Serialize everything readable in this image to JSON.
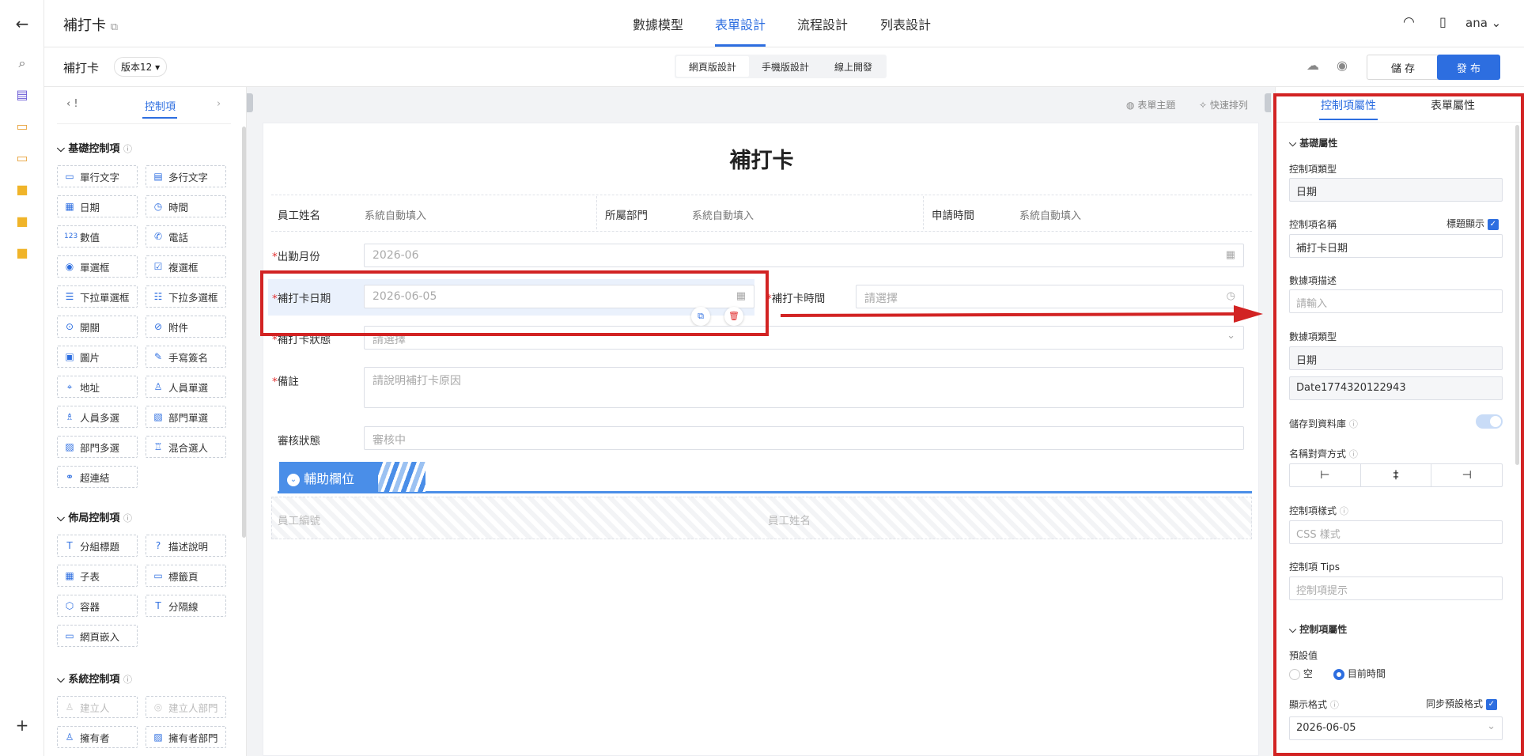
{
  "app": {
    "title": "補打卡",
    "user": "ana"
  },
  "nav": {
    "tabs": [
      "數據模型",
      "表單設計",
      "流程設計",
      "列表設計"
    ],
    "active": 1
  },
  "toolbar": {
    "form_name": "補打卡",
    "version": "版本12",
    "segments": [
      "網頁版設計",
      "手機版設計",
      "線上開發"
    ],
    "save_label": "儲 存",
    "publish_label": "發 布"
  },
  "palette": {
    "tab_label": "控制項",
    "left_tab_fragment": "!",
    "basic_title": "基礎控制項",
    "basic_items": [
      {
        "label": "單行文字",
        "icon": "▭"
      },
      {
        "label": "多行文字",
        "icon": "▤"
      },
      {
        "label": "日期",
        "icon": "▦"
      },
      {
        "label": "時間",
        "icon": "◷"
      },
      {
        "label": "數值",
        "icon": "123"
      },
      {
        "label": "電話",
        "icon": "✆"
      },
      {
        "label": "單選框",
        "icon": "◉"
      },
      {
        "label": "複選框",
        "icon": "☑"
      },
      {
        "label": "下拉單選框",
        "icon": "☰"
      },
      {
        "label": "下拉多選框",
        "icon": "☷"
      },
      {
        "label": "開關",
        "icon": "⊙"
      },
      {
        "label": "附件",
        "icon": "⊘"
      },
      {
        "label": "圖片",
        "icon": "▣"
      },
      {
        "label": "手寫簽名",
        "icon": "✎"
      },
      {
        "label": "地址",
        "icon": "⌖"
      },
      {
        "label": "人員單選",
        "icon": "♙"
      },
      {
        "label": "人員多選",
        "icon": "♗"
      },
      {
        "label": "部門單選",
        "icon": "▧"
      },
      {
        "label": "部門多選",
        "icon": "▨"
      },
      {
        "label": "混合選人",
        "icon": "♖"
      },
      {
        "label": "超連結",
        "icon": "⚭"
      }
    ],
    "layout_title": "佈局控制項",
    "layout_items": [
      {
        "label": "分組標題",
        "icon": "T"
      },
      {
        "label": "描述說明",
        "icon": "?"
      },
      {
        "label": "子表",
        "icon": "▦"
      },
      {
        "label": "標籤頁",
        "icon": "▭"
      },
      {
        "label": "容器",
        "icon": "⬡"
      },
      {
        "label": "分隔線",
        "icon": "T"
      },
      {
        "label": "網頁嵌入",
        "icon": "▭"
      }
    ],
    "system_title": "系統控制項",
    "system_items": [
      {
        "label": "建立人",
        "icon": "♙"
      },
      {
        "label": "建立人部門",
        "icon": "◎"
      },
      {
        "label": "擁有者",
        "icon": "♙"
      },
      {
        "label": "擁有者部門",
        "icon": "▨"
      }
    ]
  },
  "canvas": {
    "theme_label": "表單主題",
    "arrange_label": "快速排列",
    "form_title": "補打卡",
    "row1": [
      {
        "label": "員工姓名",
        "value": "系統自動填入"
      },
      {
        "label": "所屬部門",
        "value": "系統自動填入"
      },
      {
        "label": "申請時間",
        "value": "系統自動填入"
      }
    ],
    "month_label": "出勤月份",
    "month_placeholder": "2026-06",
    "date_label": "補打卡日期",
    "date_placeholder": "2026-06-05",
    "time_label": "補打卡時間",
    "time_placeholder": "請選擇",
    "status_label": "補打卡狀態",
    "status_placeholder": "請選擇",
    "remark_label": "備註",
    "remark_placeholder": "請說明補打卡原因",
    "review_label": "審核狀態",
    "review_placeholder": "審核中",
    "aux_title": "輔助欄位",
    "aux_fields": [
      "員工編號",
      "員工姓名"
    ]
  },
  "props": {
    "tabs": [
      "控制項屬性",
      "表單屬性"
    ],
    "basic_section": "基礎屬性",
    "type_label": "控制項類型",
    "type_value": "日期",
    "name_label": "控制項名稱",
    "show_title_label": "標題顯示",
    "name_value": "補打卡日期",
    "desc_label": "數據項描述",
    "desc_placeholder": "請輸入",
    "data_type_label": "數據項類型",
    "data_type_value": "日期",
    "field_id": "Date1774320122943",
    "save_db_label": "儲存到資料庫",
    "align_label": "名稱對齊方式",
    "style_label": "控制項樣式",
    "style_placeholder": "CSS 樣式",
    "tips_label": "控制項 Tips",
    "tips_placeholder": "控制項提示",
    "ctrl_section": "控制項屬性",
    "default_label": "預設值",
    "default_options": [
      "空",
      "目前時間"
    ],
    "format_label": "顯示格式",
    "sync_label": "同步預設格式",
    "format_value": "2026-06-05"
  },
  "colors": {
    "accent": "#2d6ee0",
    "annotation": "#d22323",
    "required": "#e23030"
  }
}
